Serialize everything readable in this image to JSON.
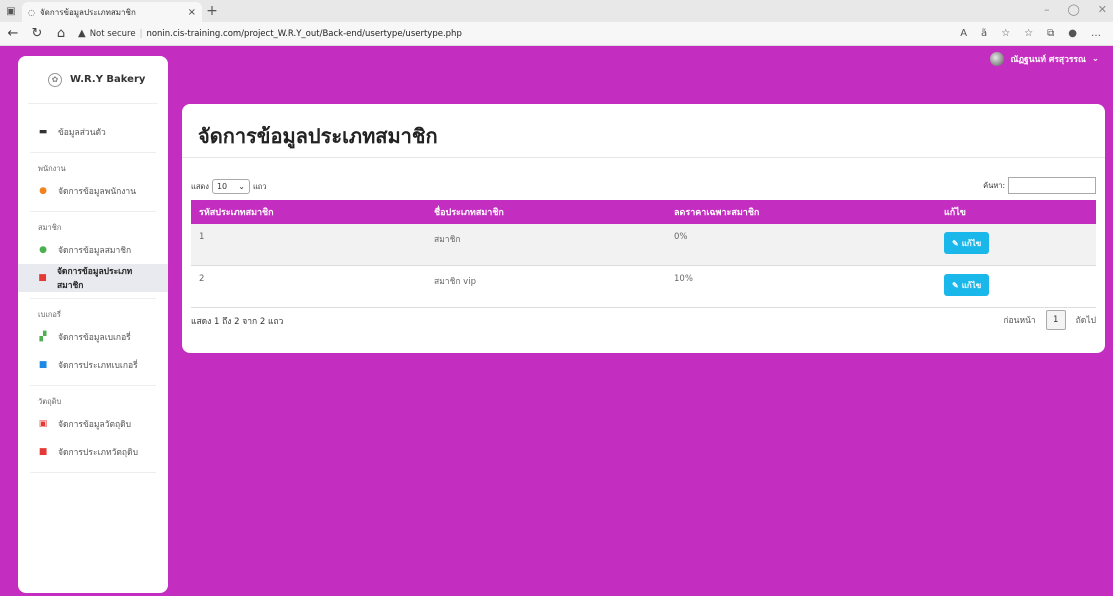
{
  "browser": {
    "tab_title": "จัดการข้อมูลประเภทสมาชิก",
    "tab_close": "×",
    "new_tab": "+",
    "not_secure": "Not secure",
    "url": "nonin.cis-training.com/project_W.R.Y_out/Back-end/usertype/usertype.php"
  },
  "sidebar": {
    "brand": "W.R.Y Bakery",
    "profile": "ข้อมูลส่วนตัว",
    "sections": [
      {
        "title": "พนักงาน",
        "items": [
          "จัดการข้อมูลพนักงาน"
        ]
      },
      {
        "title": "สมาชิก",
        "items": [
          "จัดการข้อมูลสมาชิก",
          "จัดการข้อมูลประเภทสมาชิก"
        ]
      },
      {
        "title": "เบเกอรี่",
        "items": [
          "จัดการข้อมูลเบเกอรี่",
          "จัดการประเภทเบเกอรี่"
        ]
      },
      {
        "title": "วัตถุดิบ",
        "items": [
          "จัดการข้อมูลวัตถุดิบ",
          "จัดการประเภทวัตถุดิบ"
        ]
      }
    ]
  },
  "user": {
    "name": "ณัฏฐนนท์ ศรสุวรรณ"
  },
  "main": {
    "title": "จัดการข้อมูลประเภทสมาชิก",
    "show_label": "แสดง",
    "length_value": "10",
    "rows_label": "แถว",
    "search_label": "ค้นหา:",
    "columns": [
      "รหัสประเภทสมาชิก",
      "ชื่อประเภทสมาชิก",
      "ลดราคาเฉพาะสมาชิก",
      "แก้ไข"
    ],
    "rows": [
      {
        "id": "1",
        "name": "สมาชิก",
        "discount": "0%",
        "edit": "แก้ไข"
      },
      {
        "id": "2",
        "name": "สมาชิก vip",
        "discount": "10%",
        "edit": "แก้ไข"
      }
    ],
    "info": "แสดง 1 ถึง 2 จาก 2 แถว",
    "prev": "ก่อนหน้า",
    "page": "1",
    "next": "ถัดไป"
  },
  "colors": {
    "accent": "#c42ec0",
    "button": "#1ab7ea"
  }
}
